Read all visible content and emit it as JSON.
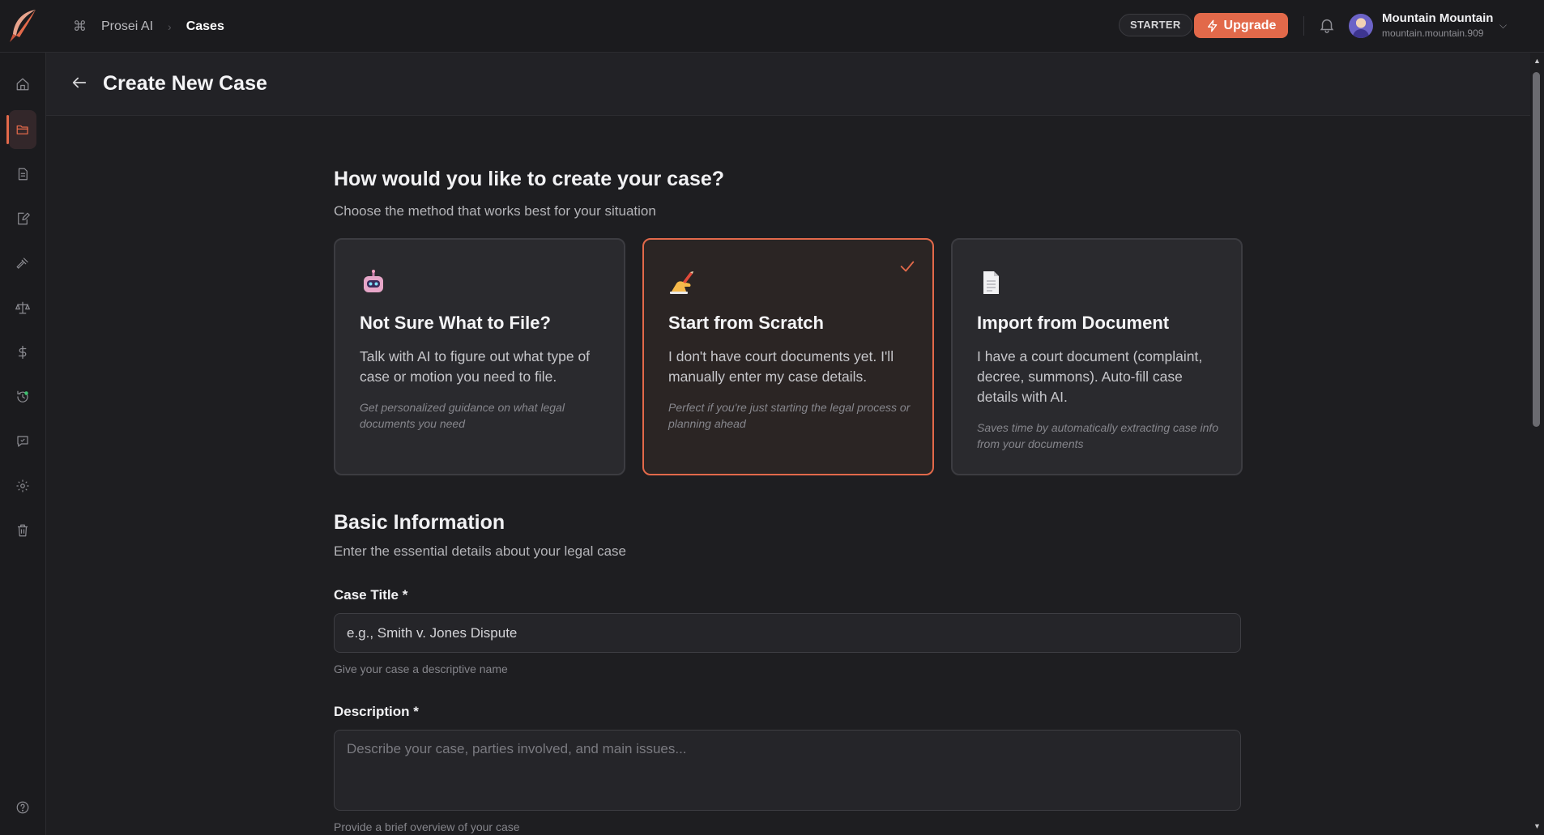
{
  "breadcrumb": {
    "root": "Prosei AI",
    "current": "Cases"
  },
  "topbar": {
    "plan_badge": "STARTER",
    "upgrade_label": "Upgrade",
    "user_name": "Mountain Mountain",
    "user_handle": "mountain.mountain.909"
  },
  "sidebar": {
    "items": [
      {
        "icon": "home-icon"
      },
      {
        "icon": "folder-icon",
        "active": true
      },
      {
        "icon": "document-icon"
      },
      {
        "icon": "edit-document-icon"
      },
      {
        "icon": "gavel-icon"
      },
      {
        "icon": "scales-icon"
      },
      {
        "icon": "dollar-icon"
      },
      {
        "icon": "history-icon"
      },
      {
        "icon": "chat-icon"
      },
      {
        "icon": "gear-icon"
      },
      {
        "icon": "trash-icon"
      },
      {
        "icon": "help-icon"
      }
    ]
  },
  "page": {
    "title": "Create New Case"
  },
  "method": {
    "heading": "How would you like to create your case?",
    "subheading": "Choose the method that works best for your situation",
    "options": [
      {
        "icon": "robot-icon",
        "title": "Not Sure What to File?",
        "description": "Talk with AI to figure out what type of case or motion you need to file.",
        "note": "Get personalized guidance on what legal documents you need",
        "selected": false
      },
      {
        "icon": "writing-hand-icon",
        "title": "Start from Scratch",
        "description": "I don't have court documents yet. I'll manually enter my case details.",
        "note": "Perfect if you're just starting the legal process or planning ahead",
        "selected": true
      },
      {
        "icon": "document-page-icon",
        "title": "Import from Document",
        "description": "I have a court document (complaint, decree, summons). Auto-fill case details with AI.",
        "note": "Saves time by automatically extracting case info from your documents",
        "selected": false
      }
    ]
  },
  "basic_info": {
    "heading": "Basic Information",
    "subheading": "Enter the essential details about your legal case",
    "case_title": {
      "label": "Case Title *",
      "placeholder": "e.g., Smith v. Jones Dispute",
      "hint": "Give your case a descriptive name"
    },
    "description": {
      "label": "Description *",
      "placeholder": "Describe your case, parties involved, and main issues...",
      "hint": "Provide a brief overview of your case"
    }
  },
  "colors": {
    "accent": "#e2694a",
    "background": "#1e1e21",
    "card": "#2a2a2e"
  }
}
